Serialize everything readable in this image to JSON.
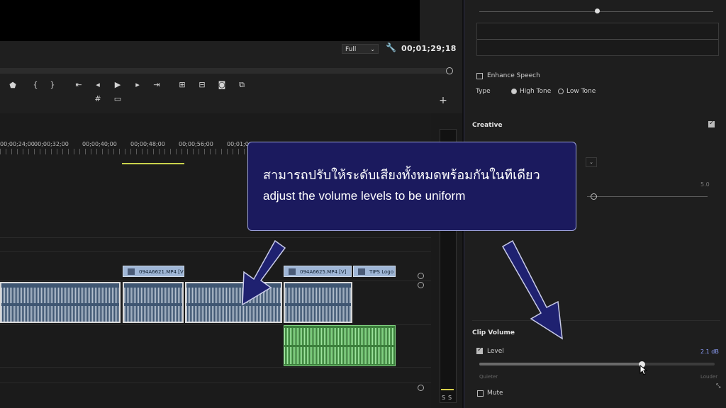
{
  "monitor": {
    "zoom_select": "Full",
    "timecode": "00;01;29;18"
  },
  "timeline": {
    "ruler_labels": [
      "00;00;24;00",
      "00;00;32;00",
      "00;00;40;00",
      "00;00;48;00",
      "00;00;56;00",
      "00;01;0"
    ],
    "clips": {
      "video_clip_1": "094A6621.MP4 [V]",
      "video_clip_2": "094A6625.MP4 [V]",
      "graphic_clip": "TIPS Logo"
    },
    "meter_labels": [
      "S",
      "S"
    ]
  },
  "panel": {
    "enhance_speech_label": "Enhance Speech",
    "type_label": "Type",
    "high_tone_label": "High Tone",
    "low_tone_label": "Low Tone",
    "creative_label": "Creative",
    "five_value": "5.0",
    "clip_volume_label": "Clip Volume",
    "level_label": "Level",
    "level_value": "2.1 dB",
    "level_fraction": 0.69,
    "quieter_label": "Quieter",
    "louder_label": "Louder",
    "mute_label": "Mute"
  },
  "callout": {
    "thai_text": "สามารถปรับให้ระดับเสียงทั้งหมดพร้อมกันในทีเดียว",
    "english_text": "adjust the volume levels to be uniform"
  },
  "colors": {
    "callout_bg": "#1b1a5e",
    "arrow": "#1f2170",
    "audio_clip": "#3f5672",
    "green_clip": "#3c7f3c",
    "level_value_color": "#8fa2ff"
  }
}
